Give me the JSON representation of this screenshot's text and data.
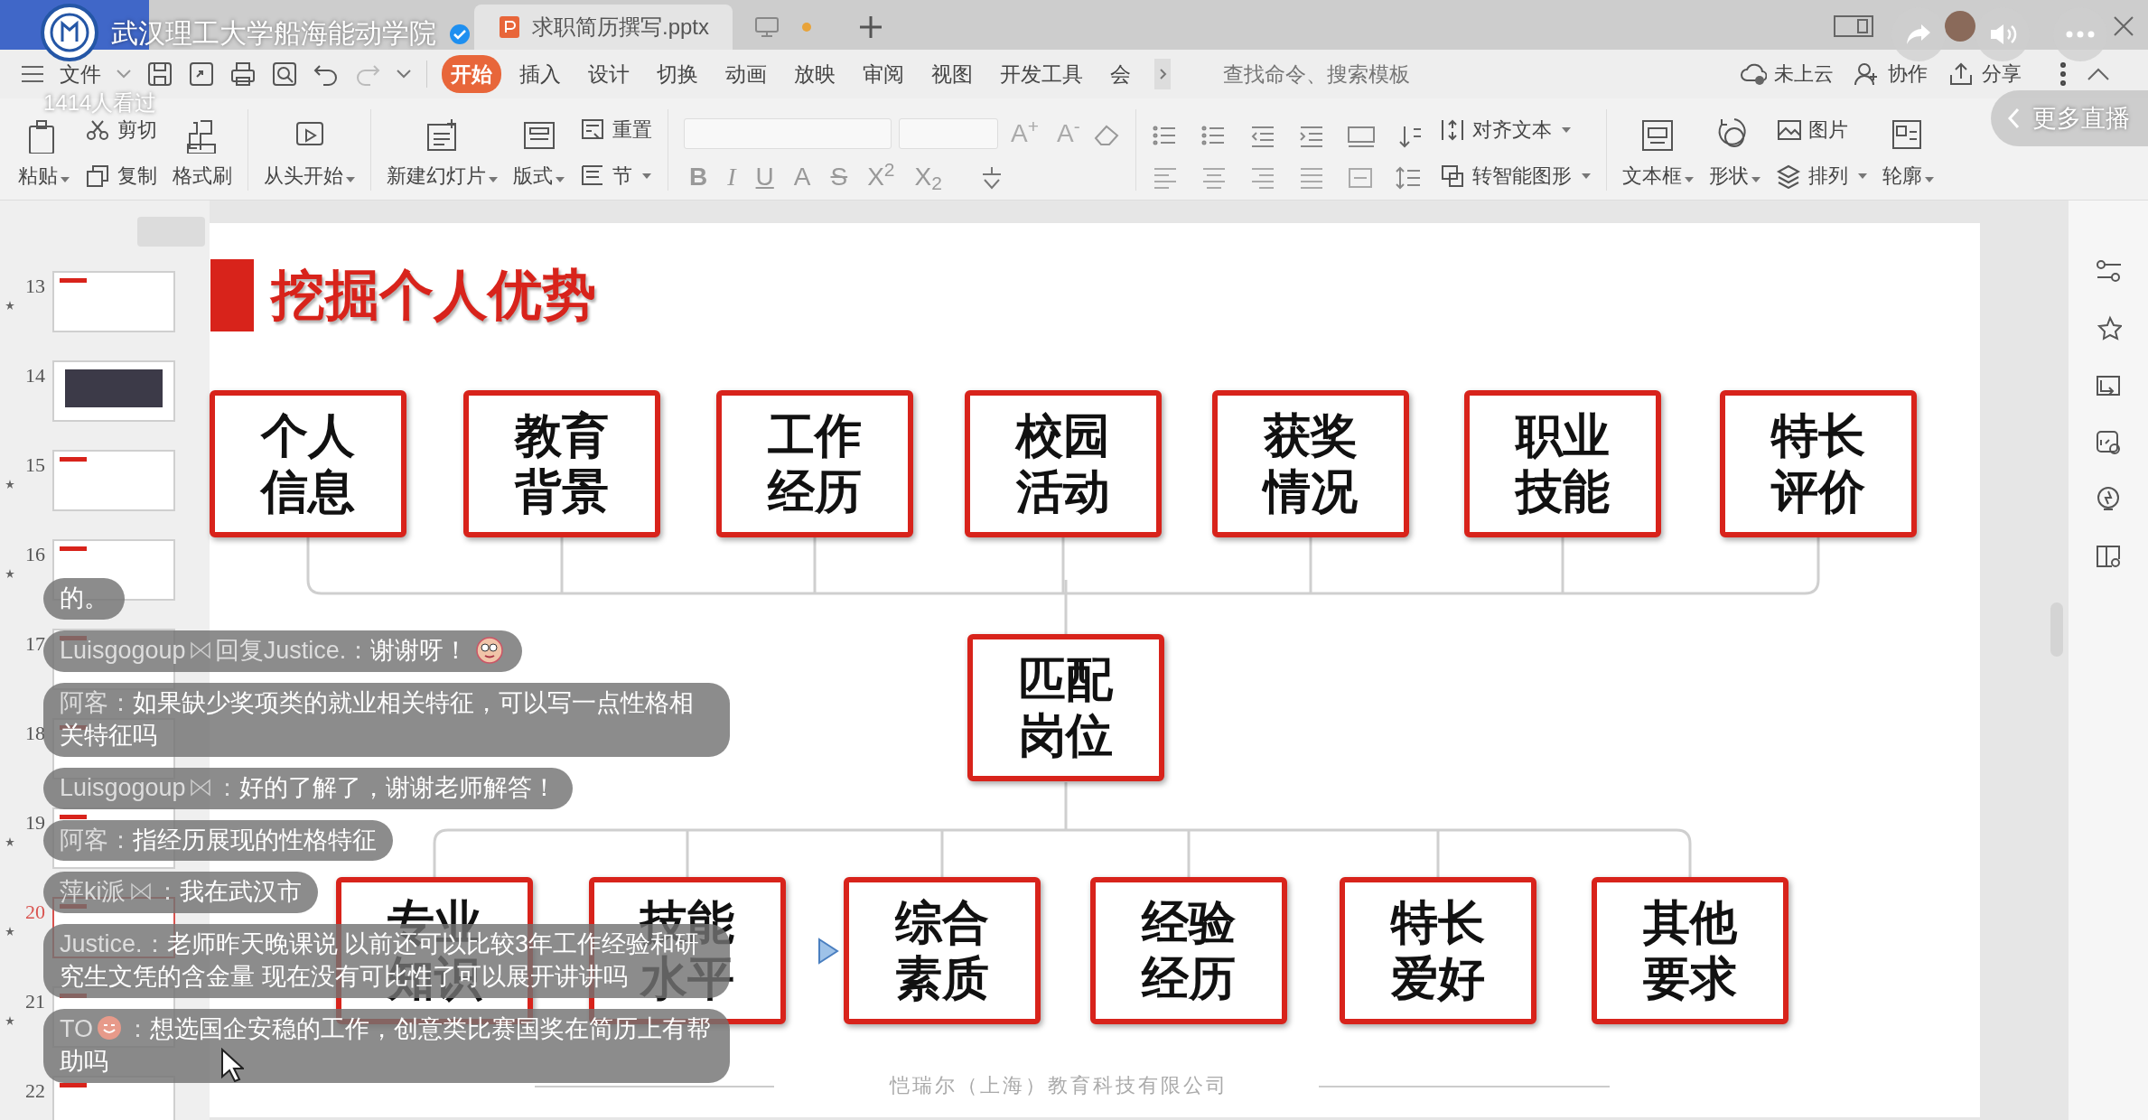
{
  "stream": {
    "channel": "武汉理工大学船海能动学院",
    "verified": true,
    "viewers": "1414人看过",
    "more_live": "更多直播"
  },
  "window": {
    "tabs": [
      {
        "label": "求职简历撰写.pptx",
        "selected": true
      }
    ]
  },
  "menu": {
    "file": "文件",
    "tabs": [
      {
        "label": "开始",
        "selected": true
      },
      {
        "label": "插入",
        "selected": false
      },
      {
        "label": "设计",
        "selected": false
      },
      {
        "label": "切换",
        "selected": false
      },
      {
        "label": "动画",
        "selected": false
      },
      {
        "label": "放映",
        "selected": false
      },
      {
        "label": "审阅",
        "selected": false
      },
      {
        "label": "视图",
        "selected": false
      },
      {
        "label": "开发工具",
        "selected": false
      },
      {
        "label": "会",
        "selected": false
      }
    ],
    "search": {
      "placeholder": "查找命令、搜索模板"
    },
    "actions": [
      "未上云",
      "协作",
      "分享"
    ]
  },
  "ribbon": [
    {
      "kind": "large",
      "label": "粘贴",
      "dropdown": true
    },
    {
      "kind": "stack",
      "items": [
        {
          "label": "剪切",
          "dropdown": false
        },
        {
          "label": "复制",
          "dropdown": false
        }
      ]
    },
    {
      "kind": "large",
      "label": "格式刷",
      "dropdown": false
    },
    {
      "kind": "large",
      "label": "从头开始",
      "dropdown": true
    },
    {
      "kind": "large",
      "label": "新建幻灯片",
      "dropdown": true
    },
    {
      "kind": "large",
      "label": "版式",
      "dropdown": true
    },
    {
      "kind": "stack",
      "items": [
        {
          "label": "重置",
          "dropdown": false
        },
        {
          "label": "节",
          "dropdown": true
        }
      ]
    },
    {
      "kind": "font",
      "size_buttons": [
        "A$^{+}$",
        "A$^{-}$"
      ],
      "format_buttons": [
        {
          "label": "B",
          "kind": "bold"
        },
        {
          "label": "I",
          "kind": "italic"
        },
        {
          "label": "U",
          "kind": "underline"
        },
        {
          "label": "A",
          "kind": "plain"
        },
        {
          "label": "S",
          "kind": "strike"
        },
        {
          "label": "X$^{2}$",
          "kind": "plain"
        },
        {
          "label": "X$_{2}$",
          "kind": "plain"
        }
      ]
    },
    {
      "kind": "paragraph"
    },
    {
      "kind": "stack",
      "items": [
        {
          "label": "对齐文本",
          "dropdown": true
        },
        {
          "label": "转智能图形",
          "dropdown": true
        }
      ]
    },
    {
      "kind": "large",
      "label": "文本框",
      "dropdown": true
    },
    {
      "kind": "large",
      "label": "形状",
      "dropdown": true
    },
    {
      "kind": "stack",
      "items": [
        {
          "label": "图片",
          "dropdown": false
        },
        {
          "label": "排列",
          "dropdown": true
        }
      ]
    },
    {
      "kind": "large",
      "label": "轮廓",
      "dropdown": true
    }
  ],
  "thumbnails": [
    {
      "number": "13",
      "starred": true,
      "selected": false,
      "kind": "slide"
    },
    {
      "number": "14",
      "starred": false,
      "selected": false,
      "kind": "photo"
    },
    {
      "number": "15",
      "starred": true,
      "selected": false,
      "kind": "slide"
    },
    {
      "number": "16",
      "starred": true,
      "selected": false,
      "kind": "slide"
    },
    {
      "number": "17",
      "starred": false,
      "selected": false,
      "kind": "slide"
    },
    {
      "number": "18",
      "starred": false,
      "selected": false,
      "kind": "slide"
    },
    {
      "number": "19",
      "starred": true,
      "selected": false,
      "kind": "slide"
    },
    {
      "number": "20",
      "starred": true,
      "selected": true,
      "kind": "slide"
    },
    {
      "number": "21",
      "starred": true,
      "selected": false,
      "kind": "slide"
    },
    {
      "number": "22",
      "starred": false,
      "selected": false,
      "kind": "slide"
    }
  ],
  "slide": {
    "title": "挖掘个人优势",
    "top_boxes": [
      "个人信息",
      "教育背景",
      "工作经历",
      "校园活动",
      "获奖情况",
      "职业技能",
      "特长评价"
    ],
    "center_box": "匹配岗位",
    "bottom_boxes": [
      "专业知识",
      "技能水平",
      "综合素质",
      "经验经历",
      "特长爱好",
      "其他要求"
    ],
    "footer": "恺瑞尔（上海）教育科技有限公司"
  },
  "chat": [
    {
      "text": "的。"
    },
    {
      "user": "Luisgogoup",
      "badge": true,
      "separator": "回复Justice.：",
      "text": "谢谢呀！",
      "emoji": true
    },
    {
      "user": "阿客",
      "badge": false,
      "separator": "：",
      "text": "如果缺少奖项类的就业相关特征，可以写一点性格相关特征吗",
      "emoji": false
    },
    {
      "user": "Luisgogoup",
      "badge": true,
      "separator": "：",
      "text": "好的了解了，谢谢老师解答！",
      "emoji": false
    },
    {
      "user": "阿客",
      "badge": false,
      "separator": "：",
      "text": "指经历展现的性格特征",
      "emoji": false
    },
    {
      "user": "萍ki派",
      "badge": true,
      "separator": "：",
      "text": "我在武汉市",
      "emoji": false
    },
    {
      "user": "Justice.",
      "badge": false,
      "separator": "：",
      "text": "老师昨天晚课说 以前还可以比较3年工作经验和研究生文凭的含金量 现在没有可比性了可以展开讲讲吗",
      "emoji": false
    },
    {
      "user": "TO",
      "name_emoji": true,
      "badge": false,
      "separator": "：",
      "text": "想选国企安稳的工作，创意类比赛国奖在简历上有帮助吗",
      "emoji": false
    }
  ]
}
